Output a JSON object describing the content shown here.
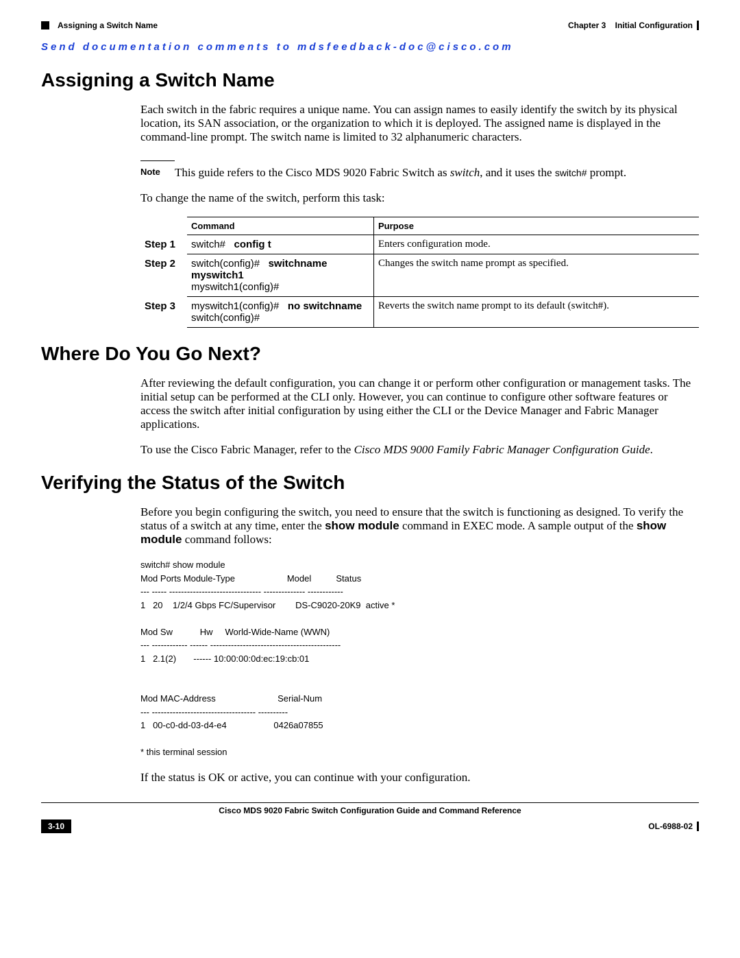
{
  "header": {
    "chapter_label": "Chapter 3",
    "chapter_title": "Initial Configuration",
    "section_breadcrumb": "Assigning a Switch Name"
  },
  "feedback_line": "Send documentation comments to mdsfeedback-doc@cisco.com",
  "assigning": {
    "heading": "Assigning a Switch Name",
    "intro": "Each switch in the fabric requires a unique name. You can assign names to easily identify the switch by its physical location, its SAN association, or the organization to which it is deployed. The assigned name is displayed in the command-line prompt. The switch name is limited to 32 alphanumeric characters.",
    "note_label": "Note",
    "note_text_pre": "This guide refers to the Cisco MDS 9020 Fabric Switch as ",
    "note_switch_word": "switch",
    "note_text_mid": ", and it uses the ",
    "note_prompt": "switch#",
    "note_text_post": " prompt.",
    "task_intro": "To change the name of the switch, perform this task:",
    "table": {
      "col_command": "Command",
      "col_purpose": "Purpose",
      "rows": [
        {
          "step": "Step 1",
          "cmd_prompt": "switch#",
          "cmd_bold": "config t",
          "cmd_line2": "",
          "purpose": "Enters configuration mode."
        },
        {
          "step": "Step 2",
          "cmd_prompt": "switch(config)#",
          "cmd_bold": "switchname myswitch1",
          "cmd_line2": "myswitch1(config)#",
          "purpose": "Changes the switch name prompt as specified."
        },
        {
          "step": "Step 3",
          "cmd_prompt": "myswitch1(config)#",
          "cmd_bold": "no switchname",
          "cmd_line2": "switch(config)#",
          "purpose": "Reverts the switch name prompt to its default (switch#)."
        }
      ]
    }
  },
  "where_next": {
    "heading": "Where Do You Go Next?",
    "para1": "After reviewing the default configuration, you can change it or perform other configuration or management tasks. The initial setup can be performed at the CLI only. However, you can continue to configure other software features or access the switch after initial configuration by using either the CLI or the Device Manager and Fabric Manager applications.",
    "para2_pre": "To use the Cisco Fabric Manager, refer to the ",
    "para2_italic": "Cisco MDS 9000 Family Fabric Manager Configuration Guide",
    "para2_post": "."
  },
  "verify": {
    "heading": "Verifying the Status of the Switch",
    "intro_pre": "Before you begin configuring the switch, you need to ensure that the switch is functioning as designed. To verify the status of a switch at any time, enter the ",
    "intro_cmd1": "show module",
    "intro_mid": " command in EXEC mode. A sample output of the ",
    "intro_cmd2": "show module",
    "intro_post": " command follows:",
    "terminal": "switch# show module\nMod Ports Module-Type                     Model          Status\n--- ----- ------------------------------- -------------- ------------\n1   20    1/2/4 Gbps FC/Supervisor        DS-C9020-20K9  active *\n\nMod Sw           Hw     World-Wide-Name (WWN)\n--- ------------ ------ --------------------------------------------\n1   2.1(2)       ------ 10:00:00:0d:ec:19:cb:01\n\n\nMod MAC-Address                         Serial-Num\n--- ----------------------------------- ----------\n1   00-c0-dd-03-d4-e4                   0426a07855\n\n* this terminal session",
    "closing": "If the status is OK or active, you can continue with your configuration."
  },
  "footer": {
    "doc_title": "Cisco MDS 9020 Fabric Switch Configuration Guide and Command Reference",
    "page_num": "3-10",
    "doc_id": "OL-6988-02"
  }
}
